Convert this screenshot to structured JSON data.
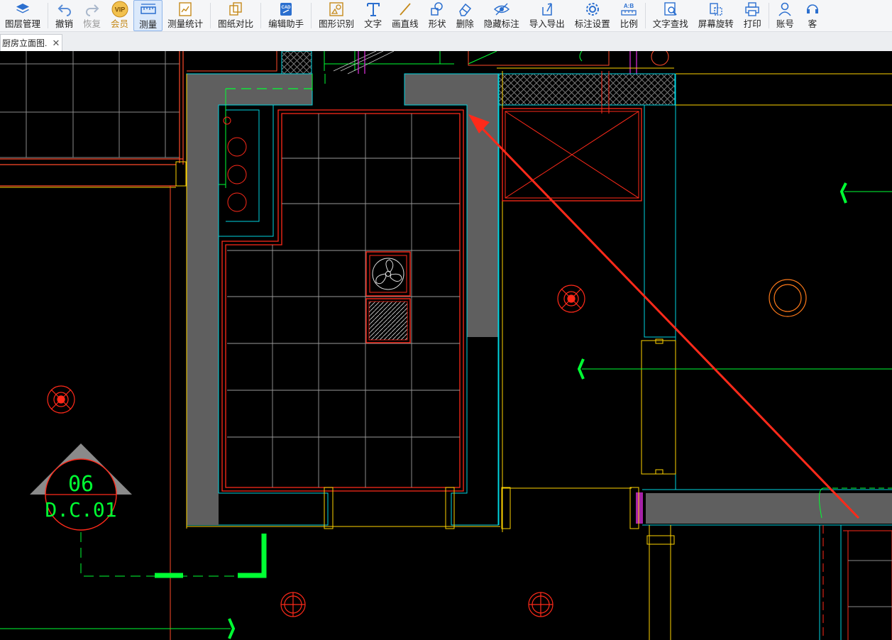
{
  "toolbar": {
    "items": [
      {
        "label": "图层管理",
        "icon": "layers-icon"
      },
      {
        "label": "撤销",
        "icon": "undo-icon"
      },
      {
        "label": "恢复",
        "icon": "redo-icon"
      },
      {
        "label": "会员",
        "icon": "vip-icon",
        "badge": "VIP"
      },
      {
        "label": "测量",
        "icon": "ruler-icon"
      },
      {
        "label": "测量统计",
        "icon": "measure-stats-icon"
      },
      {
        "label": "图纸对比",
        "icon": "compare-icon"
      },
      {
        "label": "编辑助手",
        "icon": "edit-assistant-icon",
        "badge": "CAD"
      },
      {
        "label": "图形识别",
        "icon": "shape-recognition-icon"
      },
      {
        "label": "文字",
        "icon": "text-icon"
      },
      {
        "label": "画直线",
        "icon": "line-icon"
      },
      {
        "label": "形状",
        "icon": "shape-icon"
      },
      {
        "label": "删除",
        "icon": "eraser-icon"
      },
      {
        "label": "隐藏标注",
        "icon": "eye-icon"
      },
      {
        "label": "导入导出",
        "icon": "import-export-icon"
      },
      {
        "label": "标注设置",
        "icon": "settings-icon"
      },
      {
        "label": "比例",
        "icon": "scale-icon",
        "badge": "A:B"
      },
      {
        "label": "文字查找",
        "icon": "text-search-icon"
      },
      {
        "label": "屏幕旋转",
        "icon": "rotate-icon"
      },
      {
        "label": "打印",
        "icon": "print-icon"
      },
      {
        "label": "账号",
        "icon": "account-icon"
      },
      {
        "label": "客",
        "icon": "service-icon"
      }
    ],
    "active": "测量",
    "disabled": "恢复"
  },
  "tabs": {
    "current": "厨房立面图.",
    "close": "✕"
  },
  "drawing": {
    "section_symbol": {
      "number": "06",
      "sheet": "D.C.01"
    }
  },
  "colors": {
    "background": "#000000",
    "wall_fill": "#5f5f5f",
    "annotation_arrow": "#ff2a1a",
    "accent_active": "#dbe9fb"
  }
}
